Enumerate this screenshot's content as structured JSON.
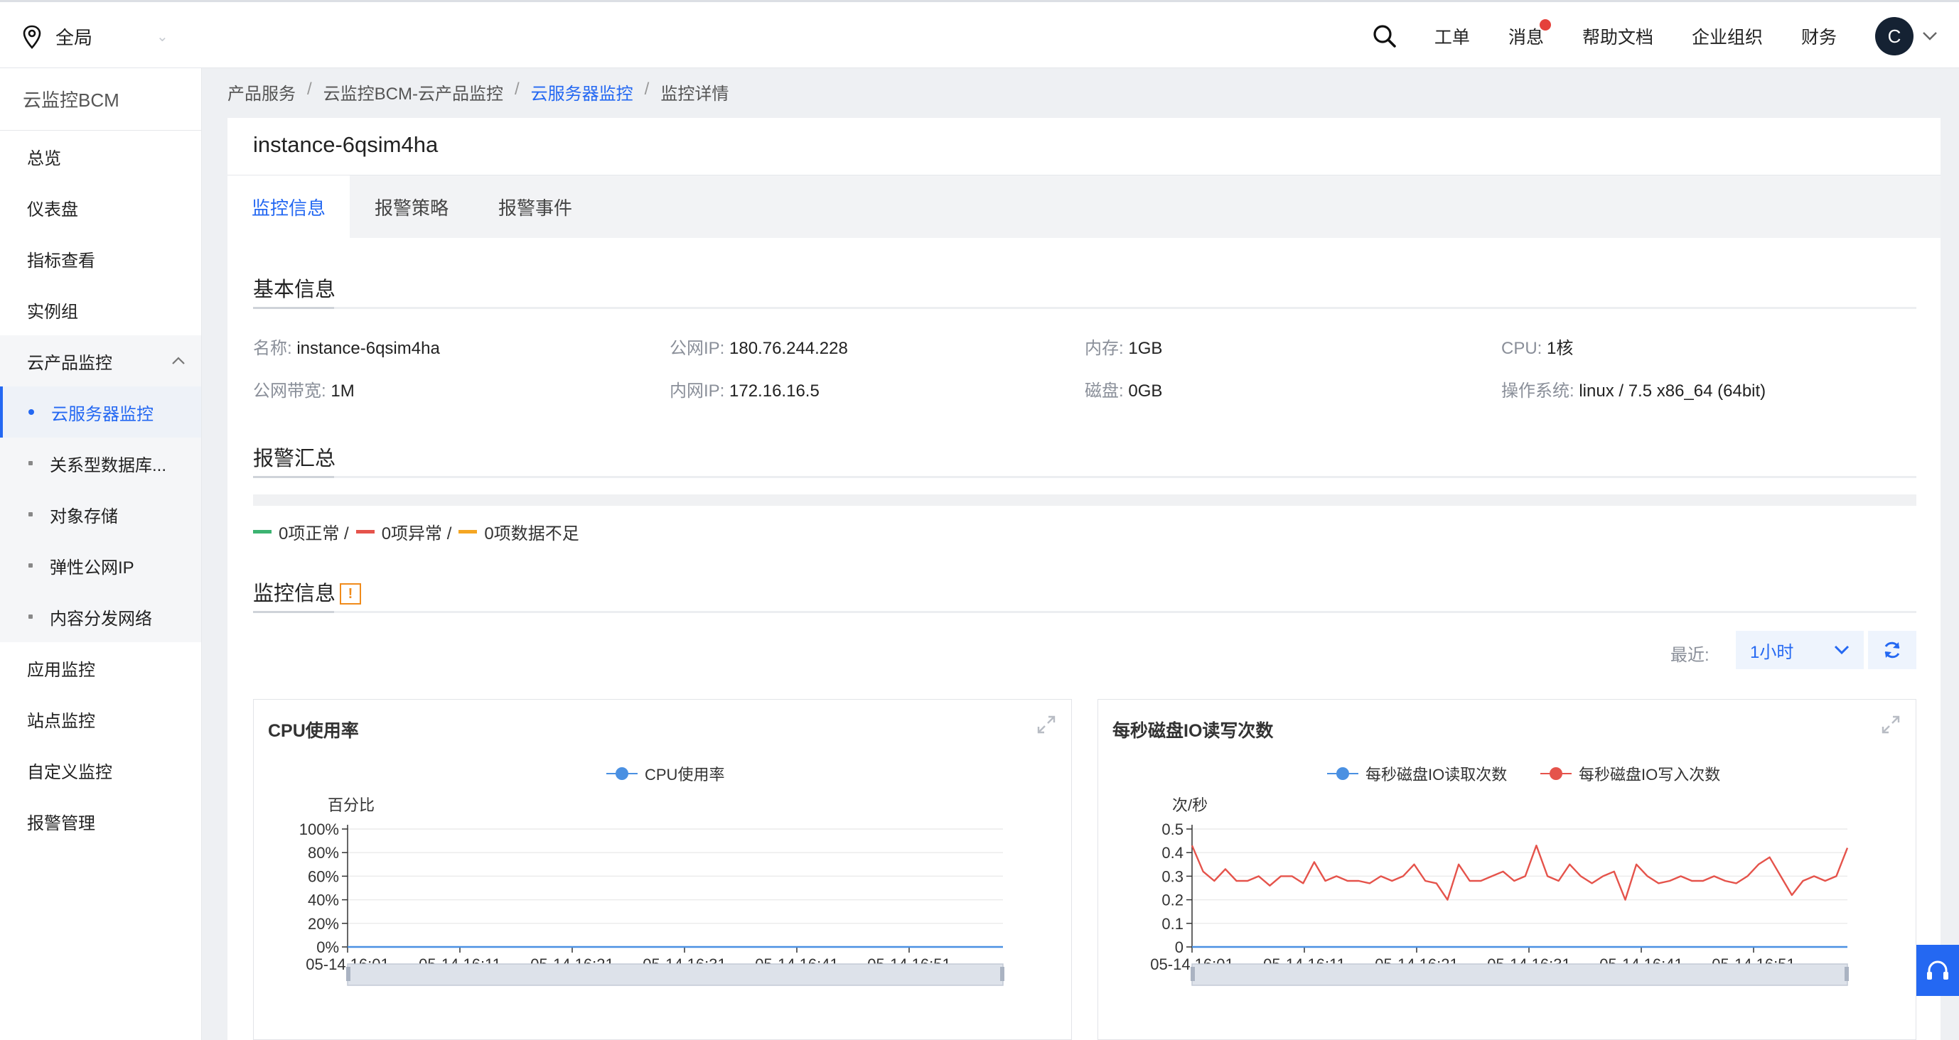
{
  "header": {
    "region_label": "全局",
    "nav": [
      "工单",
      "消息",
      "帮助文档",
      "企业组织",
      "财务"
    ],
    "avatar_letter": "C"
  },
  "sidebar": {
    "title": "云监控BCM",
    "items_top": [
      "总览",
      "仪表盘",
      "指标查看",
      "实例组"
    ],
    "group_label": "云产品监控",
    "group_items": [
      "云服务器监控",
      "关系型数据库...",
      "对象存储",
      "弹性公网IP",
      "内容分发网络"
    ],
    "items_bottom": [
      "应用监控",
      "站点监控",
      "自定义监控",
      "报警管理"
    ]
  },
  "breadcrumb": [
    "产品服务",
    "云监控BCM-云产品监控",
    "云服务器监控",
    "监控详情"
  ],
  "instance_title": "instance-6qsim4ha",
  "tabs": [
    "监控信息",
    "报警策略",
    "报警事件"
  ],
  "basic_info": {
    "title": "基本信息",
    "fields": [
      {
        "k": "名称:",
        "v": "instance-6qsim4ha"
      },
      {
        "k": "公网IP:",
        "v": "180.76.244.228"
      },
      {
        "k": "内存:",
        "v": "1GB"
      },
      {
        "k": "CPU:",
        "v": "1核"
      },
      {
        "k": "公网带宽:",
        "v": "1M"
      },
      {
        "k": "内网IP:",
        "v": "172.16.16.5"
      },
      {
        "k": "磁盘:",
        "v": "0GB"
      },
      {
        "k": "操作系统:",
        "v": "linux / 7.5 x86_64 (64bit)"
      }
    ]
  },
  "alarm_summary": {
    "title": "报警汇总",
    "normal": "0项正常 /",
    "abnormal": "0项异常 /",
    "insufficient": "0项数据不足",
    "colors": {
      "normal": "#3cb371",
      "abnormal": "#e5534b",
      "insufficient": "#f5a623"
    }
  },
  "monitor_section": {
    "title": "监控信息",
    "recent_label": "最近:",
    "recent_value": "1小时"
  },
  "chart_data": [
    {
      "type": "line",
      "title": "CPU使用率",
      "ylabel": "百分比",
      "ylim": [
        0,
        100
      ],
      "y_ticks": [
        "100%",
        "80%",
        "60%",
        "40%",
        "20%",
        "0%"
      ],
      "x_ticks": [
        "05-14 16:01",
        "05-14 16:11",
        "05-14 16:21",
        "05-14 16:31",
        "05-14 16:41",
        "05-14 16:51"
      ],
      "series": [
        {
          "name": "CPU使用率",
          "color": "#4a90e2",
          "values": [
            0,
            0,
            0,
            0,
            0,
            0,
            0,
            0,
            0,
            0,
            0,
            0,
            0,
            0,
            0,
            0,
            0,
            0,
            0,
            0,
            0,
            0,
            0,
            0,
            0,
            0,
            0,
            0,
            0,
            0,
            0,
            0,
            0,
            0,
            0,
            0,
            0,
            0,
            0,
            0,
            0,
            0,
            0,
            0,
            0,
            0,
            0,
            0,
            0,
            0,
            0,
            0,
            0,
            0,
            0,
            0,
            0,
            0,
            0,
            0
          ]
        }
      ]
    },
    {
      "type": "line",
      "title": "每秒磁盘IO读写次数",
      "ylabel": "次/秒",
      "ylim": [
        0,
        0.5
      ],
      "y_ticks": [
        "0.5",
        "0.4",
        "0.3",
        "0.2",
        "0.1",
        "0"
      ],
      "x_ticks": [
        "05-14 16:01",
        "05-14 16:11",
        "05-14 16:21",
        "05-14 16:31",
        "05-14 16:41",
        "05-14 16:51"
      ],
      "series": [
        {
          "name": "每秒磁盘IO读取次数",
          "color": "#4a90e2",
          "values": [
            0,
            0,
            0,
            0,
            0,
            0,
            0,
            0,
            0,
            0,
            0,
            0,
            0,
            0,
            0,
            0,
            0,
            0,
            0,
            0,
            0,
            0,
            0,
            0,
            0,
            0,
            0,
            0,
            0,
            0,
            0,
            0,
            0,
            0,
            0,
            0,
            0,
            0,
            0,
            0,
            0,
            0,
            0,
            0,
            0,
            0,
            0,
            0,
            0,
            0,
            0,
            0,
            0,
            0,
            0,
            0,
            0,
            0,
            0,
            0
          ]
        },
        {
          "name": "每秒磁盘IO写入次数",
          "color": "#e5534b",
          "values": [
            0.43,
            0.32,
            0.28,
            0.33,
            0.28,
            0.28,
            0.3,
            0.26,
            0.3,
            0.3,
            0.27,
            0.36,
            0.28,
            0.3,
            0.28,
            0.28,
            0.27,
            0.3,
            0.28,
            0.3,
            0.35,
            0.28,
            0.27,
            0.2,
            0.35,
            0.28,
            0.28,
            0.3,
            0.32,
            0.28,
            0.3,
            0.43,
            0.3,
            0.28,
            0.35,
            0.3,
            0.27,
            0.3,
            0.32,
            0.2,
            0.35,
            0.3,
            0.27,
            0.28,
            0.3,
            0.28,
            0.28,
            0.3,
            0.28,
            0.27,
            0.3,
            0.35,
            0.38,
            0.3,
            0.22,
            0.28,
            0.3,
            0.28,
            0.3,
            0.42
          ]
        }
      ]
    }
  ]
}
